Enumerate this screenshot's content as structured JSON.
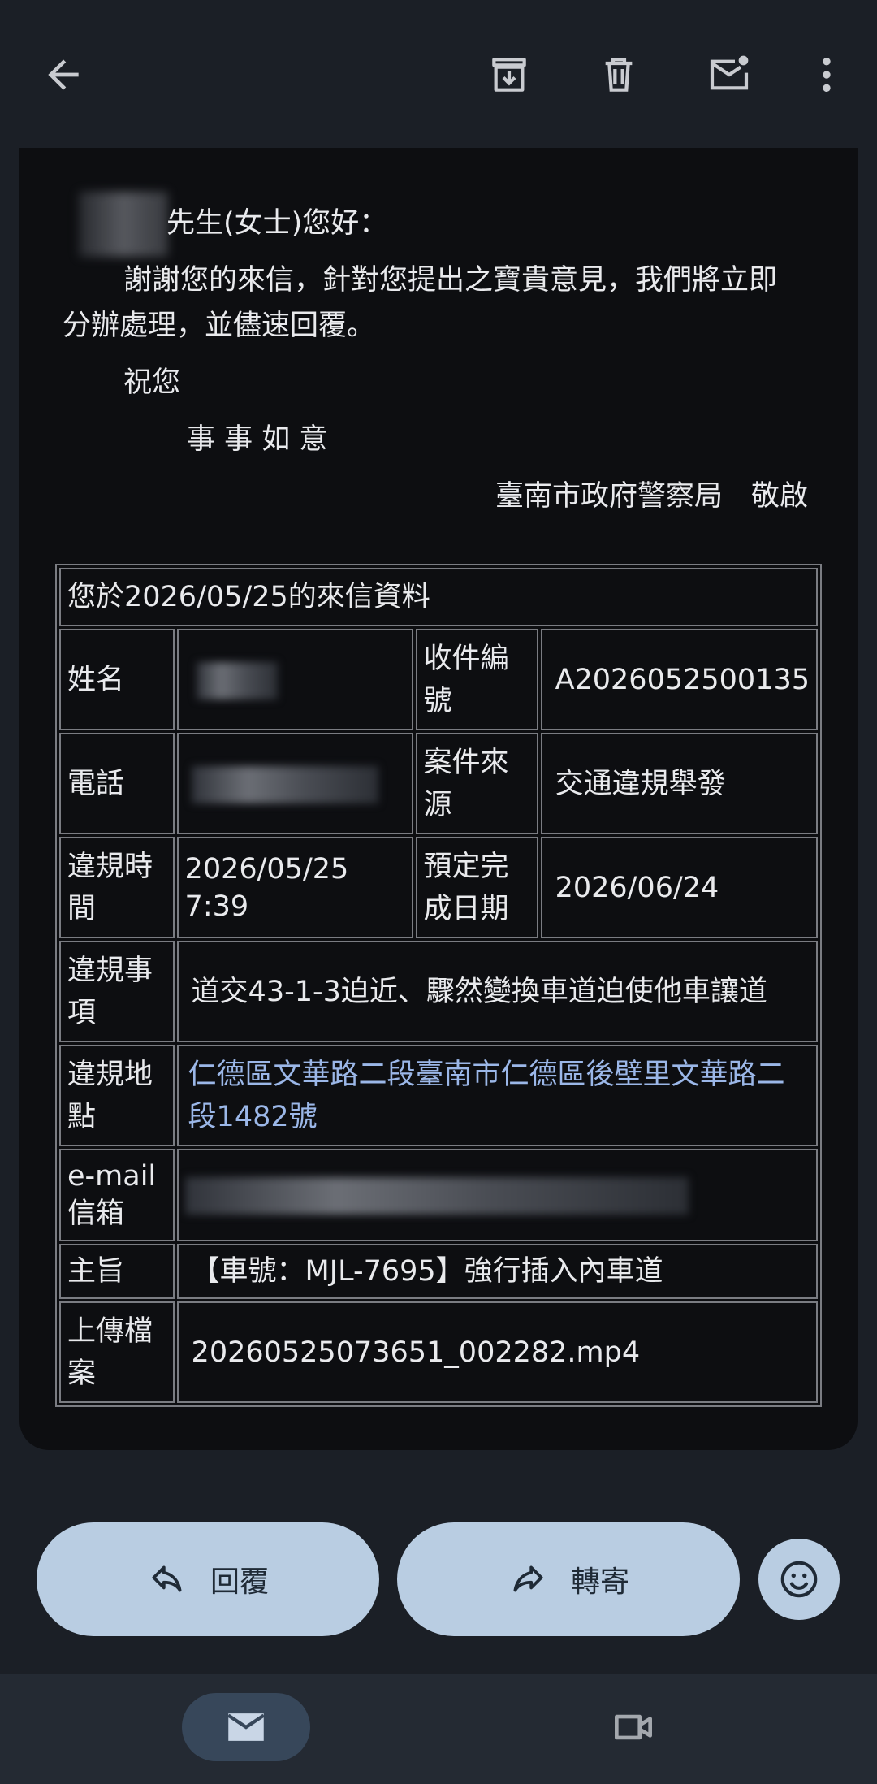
{
  "toolbar": {
    "back_icon": "arrow-left-icon",
    "archive_icon": "archive-icon",
    "delete_icon": "trash-icon",
    "unread_icon": "mark-unread-icon",
    "more_icon": "more-vert-icon"
  },
  "letter": {
    "greeting": "先生(女士)您好：",
    "line1": "謝謝您的來信，針對您提出之寶貴意見，我們將立即",
    "line2": "分辦處理，並儘速回覆。",
    "closing1": "祝您",
    "closing2": "事 事 如 意",
    "signature": "臺南市政府警察局　敬啟"
  },
  "table": {
    "header": "您於2026/05/25的來信資料",
    "name_label": "姓名",
    "case_no_label": "收件編號",
    "case_no": "A2026052500135",
    "phone_label": "電話",
    "source_label": "案件來源",
    "source": "交通違規舉發",
    "time_label": "違規時間",
    "time_value": "2026/05/25 7:39",
    "due_label": "預定完成日期",
    "due_value": "2026/06/24",
    "item_label": "違規事項",
    "item_value": "道交43-1-3迫近、驟然變換車道迫使他車讓道",
    "place_label": "違規地點",
    "place_value": "仁德區文華路二段臺南市仁德區後壁里文華路二段1482號",
    "email_label": "e-mail信箱",
    "subject_label": "主旨",
    "subject_value": "【車號：MJL-7695】強行插入內車道",
    "file_label": "上傳檔案",
    "file_value": "20260525073651_002282.mp4"
  },
  "actions": {
    "reply": "回覆",
    "forward": "轉寄",
    "emoji_icon": "smiley-icon"
  },
  "nav": {
    "mail_icon": "mail-icon",
    "meet_icon": "video-icon"
  }
}
